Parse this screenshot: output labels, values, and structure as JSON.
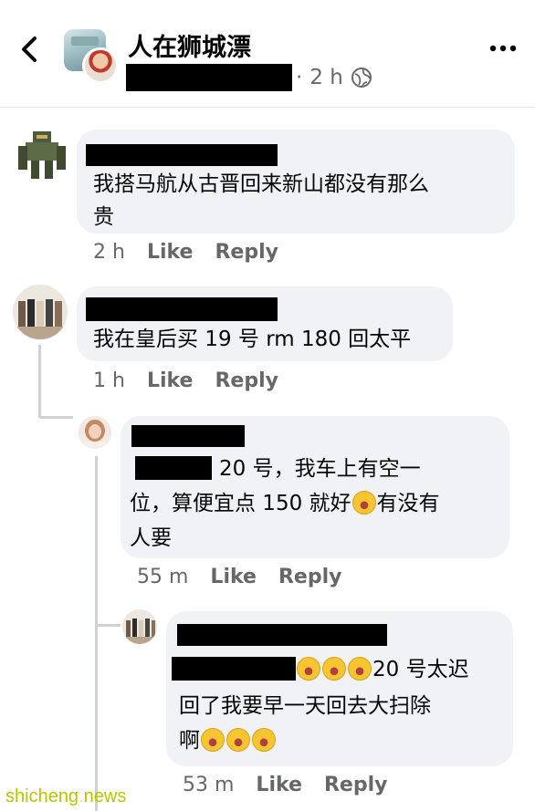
{
  "header": {
    "group_name": "人在狮城漂",
    "dot": "·",
    "time": "2 h",
    "back_icon": "chevron-left-icon",
    "more_icon": "more-horizontal-icon",
    "privacy_icon": "globe-icon"
  },
  "comments": [
    {
      "text_line1": "我搭马航从古晋回来新山都没有那么",
      "text_line2": "贵",
      "time": "2 h",
      "like": "Like",
      "reply": "Reply"
    },
    {
      "text": "我在皇后买 19 号 rm 180 回太平",
      "time": "1 h",
      "like": "Like",
      "reply": "Reply"
    },
    {
      "text_line1_after_redaction": "20 号，我车上有空一",
      "text_line2_a": "位，算便宜点 150 就好",
      "text_line2_b": "有没有",
      "text_line3": "人要",
      "time": "55 m",
      "like": "Like",
      "reply": "Reply"
    },
    {
      "text_line1_after_redaction": "20 号太迟",
      "text_line2": "回了我要早一天回去大扫除",
      "text_line3": "啊",
      "time": "53 m",
      "like": "Like",
      "reply": "Reply"
    }
  ],
  "emoji_names": [
    "rolling-on-floor-laughing",
    "face-with-tears-of-joy"
  ],
  "watermark": {
    "left": "shicheng",
    "dot": ".",
    "right": "news"
  },
  "colors": {
    "bubble": "#f0f2f5",
    "meta_text": "#65676b",
    "thread_line": "#ced0d4"
  }
}
